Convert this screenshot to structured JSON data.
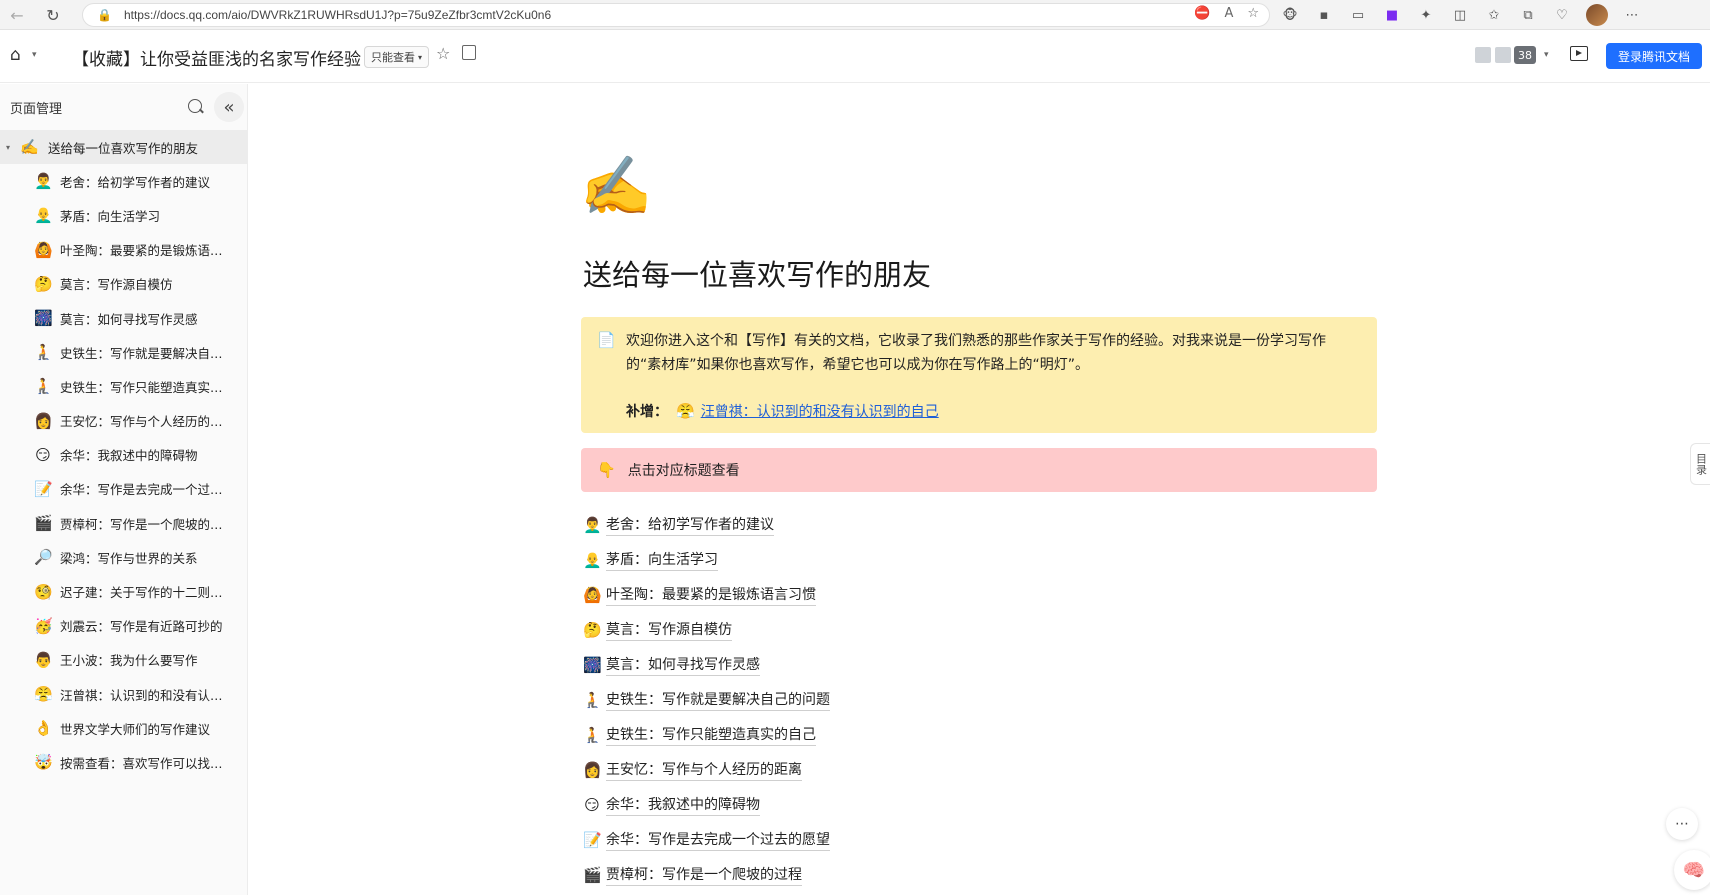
{
  "browser": {
    "url": "https://docs.qq.com/aio/DWVRkZ1RUWHRsdU1J?p=75u9ZeZfbr3cmtV2cKu0n6"
  },
  "header": {
    "title": "【收藏】让你受益匪浅的名家写作经验",
    "mode_label": "只能查看",
    "collaborator_count": "38",
    "login_label": "登录腾讯文档"
  },
  "sidebar": {
    "title": "页面管理",
    "root": {
      "icon": "✍️",
      "label": "送给每一位喜欢写作的朋友"
    },
    "items": [
      {
        "icon": "👨‍🦱",
        "label": "老舍：给初学写作者的建议"
      },
      {
        "icon": "👨‍🦲",
        "label": "茅盾：向生活学习"
      },
      {
        "icon": "🙆",
        "label": "叶圣陶：最要紧的是锻炼语言习惯"
      },
      {
        "icon": "🤔",
        "label": "莫言：写作源自模仿"
      },
      {
        "icon": "🎆",
        "label": "莫言：如何寻找写作灵感"
      },
      {
        "icon": "🧎",
        "label": "史铁生：写作就是要解决自己的问题"
      },
      {
        "icon": "🧎",
        "label": "史铁生：写作只能塑造真实的自己"
      },
      {
        "icon": "👩",
        "label": "王安忆：写作与个人经历的距离"
      },
      {
        "icon": "😏",
        "label": "余华：我叙述中的障碍物"
      },
      {
        "icon": "📝",
        "label": "余华：写作是去完成一个过去的愿望"
      },
      {
        "icon": "🎬",
        "label": "贾樟柯：写作是一个爬坡的过程"
      },
      {
        "icon": "🔎",
        "label": "梁鸿：写作与世界的关系"
      },
      {
        "icon": "🧐",
        "label": "迟子建：关于写作的十二则箴言"
      },
      {
        "icon": "🥳",
        "label": "刘震云：写作是有近路可抄的"
      },
      {
        "icon": "👨",
        "label": "王小波：我为什么要写作"
      },
      {
        "icon": "😤",
        "label": "汪曾祺：认识到的和没有认识到的自己"
      },
      {
        "icon": "👌",
        "label": "世界文学大师们的写作建议"
      },
      {
        "icon": "🤯",
        "label": "按需查看：喜欢写作可以找什么书看"
      }
    ]
  },
  "document": {
    "hero_icon": "✍️",
    "heading": "送给每一位喜欢写作的朋友",
    "intro_icon": "📄",
    "intro_text": "欢迎你进入这个和【写作】有关的文档，它收录了我们熟悉的那些作家关于写作的经验。对我来说是一份学习写作的“素材库”如果你也喜欢写作，希望它也可以成为你在写作路上的“明灯”。",
    "supplement_label": "补增：",
    "supplement_icon": "😤",
    "supplement_link": "汪曾祺：认识到的和没有认识到的自己",
    "hint_icon": "👇",
    "hint_text": "点击对应标题查看",
    "links": [
      {
        "icon": "👨‍🦱",
        "label": "老舍：给初学写作者的建议"
      },
      {
        "icon": "👨‍🦲",
        "label": "茅盾：向生活学习"
      },
      {
        "icon": "🙆",
        "label": "叶圣陶：最要紧的是锻炼语言习惯"
      },
      {
        "icon": "🤔",
        "label": "莫言：写作源自模仿"
      },
      {
        "icon": "🎆",
        "label": "莫言：如何寻找写作灵感"
      },
      {
        "icon": "🧎",
        "label": "史铁生：写作就是要解决自己的问题"
      },
      {
        "icon": "🧎",
        "label": "史铁生：写作只能塑造真实的自己"
      },
      {
        "icon": "👩",
        "label": "王安忆：写作与个人经历的距离"
      },
      {
        "icon": "😏",
        "label": "余华：我叙述中的障碍物"
      },
      {
        "icon": "📝",
        "label": "余华：写作是去完成一个过去的愿望"
      },
      {
        "icon": "🎬",
        "label": "贾樟柯：写作是一个爬坡的过程"
      }
    ]
  },
  "float": {
    "toc_label": "目录"
  }
}
